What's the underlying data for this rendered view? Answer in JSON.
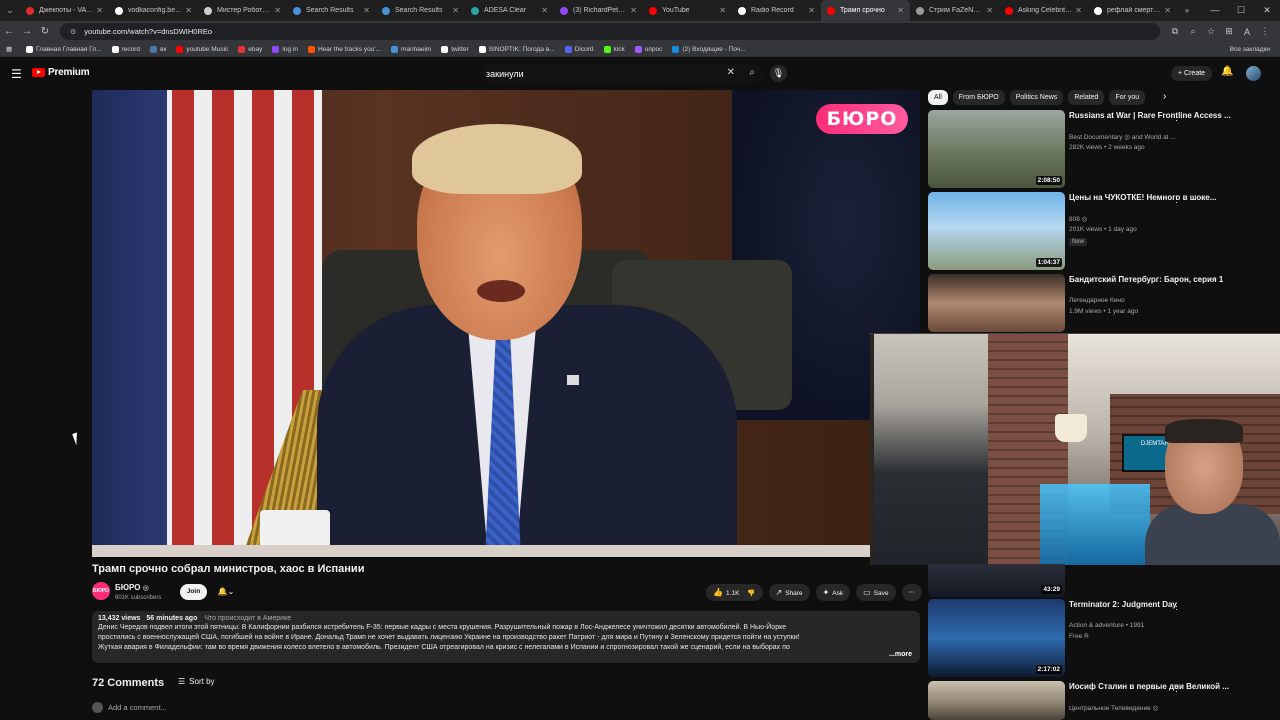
{
  "browser": {
    "tabs": [
      {
        "label": "Джекпоты - VAVAD",
        "color": "#e02b2b"
      },
      {
        "label": "vodkaconfig.bet | Б",
        "color": "#ffffff"
      },
      {
        "label": "Мистер Роботт (1-4",
        "color": "#cccccc"
      },
      {
        "label": "Search Results",
        "color": "#4a90d9"
      },
      {
        "label": "Search Results",
        "color": "#4a90d9"
      },
      {
        "label": "ADESA Clear",
        "color": "#2aa5a0"
      },
      {
        "label": "(3) RichardPetrovic",
        "color": "#9146ff"
      },
      {
        "label": "YouTube",
        "color": "#ff0000"
      },
      {
        "label": "Radio Record",
        "color": "#ffffff"
      },
      {
        "label": "Трамп срочно",
        "color": "#ff0000",
        "active": true
      },
      {
        "label": "Стрим FaZeNDA67",
        "color": "#9a9a9a"
      },
      {
        "label": "Asking Celebrity 8/",
        "color": "#ff0000"
      },
      {
        "label": "рефлай смерть в эт",
        "color": "#ffffff"
      }
    ],
    "url": "youtube.com/watch?v=dnsDWIH0REo",
    "bookmarks": [
      {
        "label": "Главная Главная Гл...",
        "color": "#ffffff"
      },
      {
        "label": "record",
        "color": "#ffffff"
      },
      {
        "label": "вк",
        "color": "#4a76a8"
      },
      {
        "label": "youtube Music",
        "color": "#ff0000"
      },
      {
        "label": "ebay",
        "color": "#e53238"
      },
      {
        "label": "log in",
        "color": "#9146ff"
      },
      {
        "label": "Hear the tracks you'...",
        "color": "#ff5500"
      },
      {
        "label": "manhaeim",
        "color": "#4a90d9"
      },
      {
        "label": "twitter",
        "color": "#ffffff"
      },
      {
        "label": "SINOPTIK: Погода в...",
        "color": "#ffffff"
      },
      {
        "label": "Dicord",
        "color": "#5865f2"
      },
      {
        "label": "kick",
        "color": "#53fc18"
      },
      {
        "label": "опрос",
        "color": "#a259ff"
      },
      {
        "label": "(2) Входящие - Поч...",
        "color": "#168de2"
      }
    ],
    "bookmarks_right": "Все закладки"
  },
  "masthead": {
    "logo": "Premium",
    "search_value": "закинули",
    "create_label": "Create"
  },
  "player": {
    "watermark": "БЮРО"
  },
  "webcam": {
    "tv_text": "DJEMTAЯH"
  },
  "video": {
    "title": "Трамп срочно собрал министров, хаос в Испании",
    "channel": "БЮРО",
    "channel_badge": "◎",
    "avatar_text": "БЮРО",
    "subscribers": "601K subscribers",
    "join_label": "Join",
    "likes": "1.1K",
    "share_label": "Share",
    "ask_label": "Ask",
    "save_label": "Save",
    "views": "13,432 views",
    "time_ago": "56 minutes ago",
    "tag": "Что происходит в Америке",
    "description_lines": [
      "Денис Чередов подвел итоги этой пятницы: В Калифорнии разбился истребитель F-35: первые кадры с места крушения. Разрушительный пожар в Лос-Анджелесе уничтожил десятки автомобилей. В Нью-Йорке",
      "простились с военнослужащей США, погибшей на войне в Иране. Дональд Трамп не хочет выдавать лицензию Украине на производство ракет Патриот - для мира и Путину и Зеленскому придется пойти на уступки!",
      "Жуткая авария в Филадельфии: там во время движения колесо влетело в автомобиль. Президент США отреагировал на кризис с нелегалами в Испании и спрогнозировал такой же сценарий, если на выборах по"
    ],
    "more_label": "...more"
  },
  "comments": {
    "count_label": "72 Comments",
    "sort_label": "Sort by",
    "placeholder": "Add a comment..."
  },
  "rail": {
    "chips": [
      {
        "label": "All",
        "active": true
      },
      {
        "label": "From БЮРО"
      },
      {
        "label": "Politics News"
      },
      {
        "label": "Related"
      },
      {
        "label": "For you"
      }
    ],
    "items": [
      {
        "title": "Russians at War | Rare Frontline Access ...",
        "channel": "Best Documentary ◎ and World at ...",
        "meta": "282K views • 2 weeks ago",
        "duration": "2:08:50",
        "badge": "",
        "thumb": "linear-gradient(180deg,#9aa8a0 0%,#6e7b64 50%,#4a5540 100%)"
      },
      {
        "title": "Цены на ЧУКОТКЕ! Немного в шоке...",
        "channel": "808 ◎",
        "meta": "201K views • 1 day ago",
        "duration": "1:04:37",
        "badge": "New",
        "thumb": "linear-gradient(180deg,#6fb3e8 0%,#b6d8f0 45%,#8a9a7c 100%)"
      },
      {
        "title": "Бандитский Петербург: Барон, серия 1",
        "channel": "Легендарное Кино",
        "meta": "1.9M views • 1 year ago",
        "duration": "",
        "badge": "",
        "thumb": "linear-gradient(180deg,#3a2e26 0%,#b08870 50%,#6a4a3a 100%)"
      },
      {
        "title": "Terminator 2: Judgment Day",
        "channel": "Action & adventure • 1991",
        "meta": "Free  R",
        "duration": "2:17:02",
        "badge": "",
        "thumb": "linear-gradient(180deg,#1c3a6e 0%,#2f6bb0 50%,#0e1a30 100%)"
      },
      {
        "title": "Иосиф Сталин в первые дни Великой ...",
        "channel": "Центральное Телевидение ◎",
        "meta": "",
        "duration": "",
        "badge": "",
        "thumb": "linear-gradient(180deg,#c8c0b0 0%,#8a7f6c 60%,#4a4238 100%)"
      }
    ],
    "hidden_item_duration": "43:29"
  }
}
